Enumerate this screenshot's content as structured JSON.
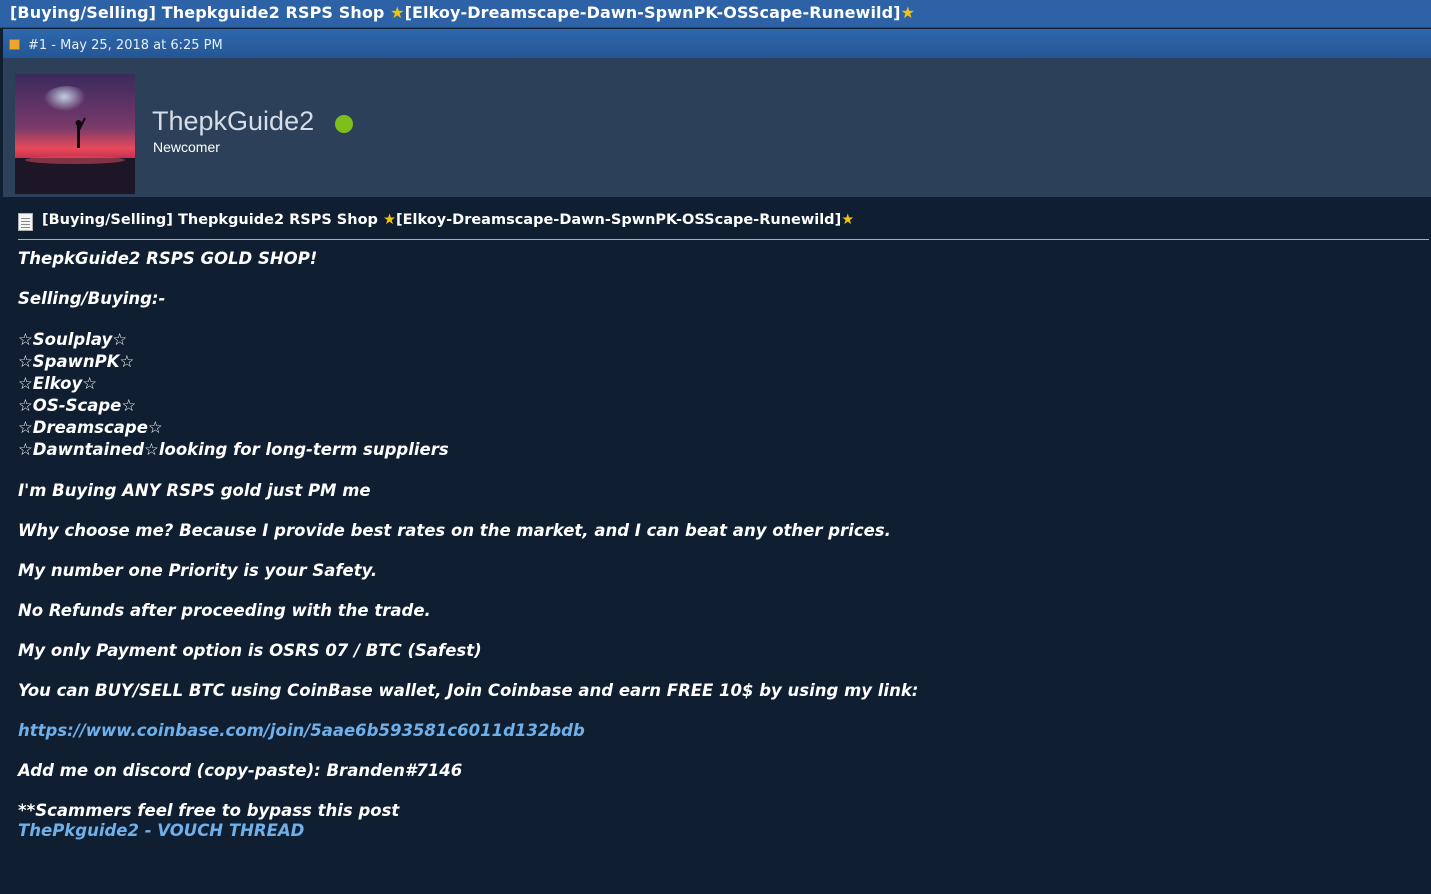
{
  "thread": {
    "title_prefix": "[Buying/Selling] Thepkguide2 RSPS Shop ",
    "star": "★",
    "title_middle": "[Elkoy-Dreamscape-Dawn-SpwnPK-OSScape-Runewild]",
    "post_meta": "#1 - May 25, 2018 at 6:25 PM"
  },
  "author": {
    "username": "ThepkGuide2",
    "user_title": "Newcomer",
    "online_color": "#7fbf1b"
  },
  "post": {
    "subject_prefix": "[Buying/Selling] Thepkguide2 RSPS Shop ",
    "subject_middle": "[Elkoy-Dreamscape-Dawn-SpwnPK-OSScape-Runewild]",
    "heading": "ThepkGuide2 RSPS GOLD SHOP!",
    "selling_buying": "Selling/Buying:-",
    "outline_star": "☆",
    "servers": [
      "Soulplay",
      "SpawnPK",
      "Elkoy",
      "OS-Scape",
      "Dreamscape",
      "Dawntained"
    ],
    "suppliers_note": "looking for long-term suppliers",
    "buying": "I'm Buying ANY RSPS gold just PM me",
    "why": "Why choose me? Because I provide best rates on the market, and I can beat any other prices.",
    "priority": "My number one Priority is your Safety.",
    "refunds": "No Refunds after proceeding with the trade.",
    "payment": "My only Payment option is OSRS 07 / BTC (Safest)",
    "coinbase": "You can BUY/SELL BTC using CoinBase wallet, Join Coinbase and earn FREE 10$ by using my link:",
    "link": "https://www.coinbase.com/join/5aae6b593581c6011d132bdb",
    "discord": "Add me on discord (copy-paste): Branden#7146",
    "scammers": "**Scammers feel free to bypass this post",
    "vouch_link": "ThePkguide2 - VOUCH THREAD"
  },
  "colors": {
    "title_bar": "#2d62a6",
    "author_panel": "#2d4059",
    "post_bg": "#0f1e30",
    "link": "#6fb0ea",
    "star": "#f4c20d"
  }
}
